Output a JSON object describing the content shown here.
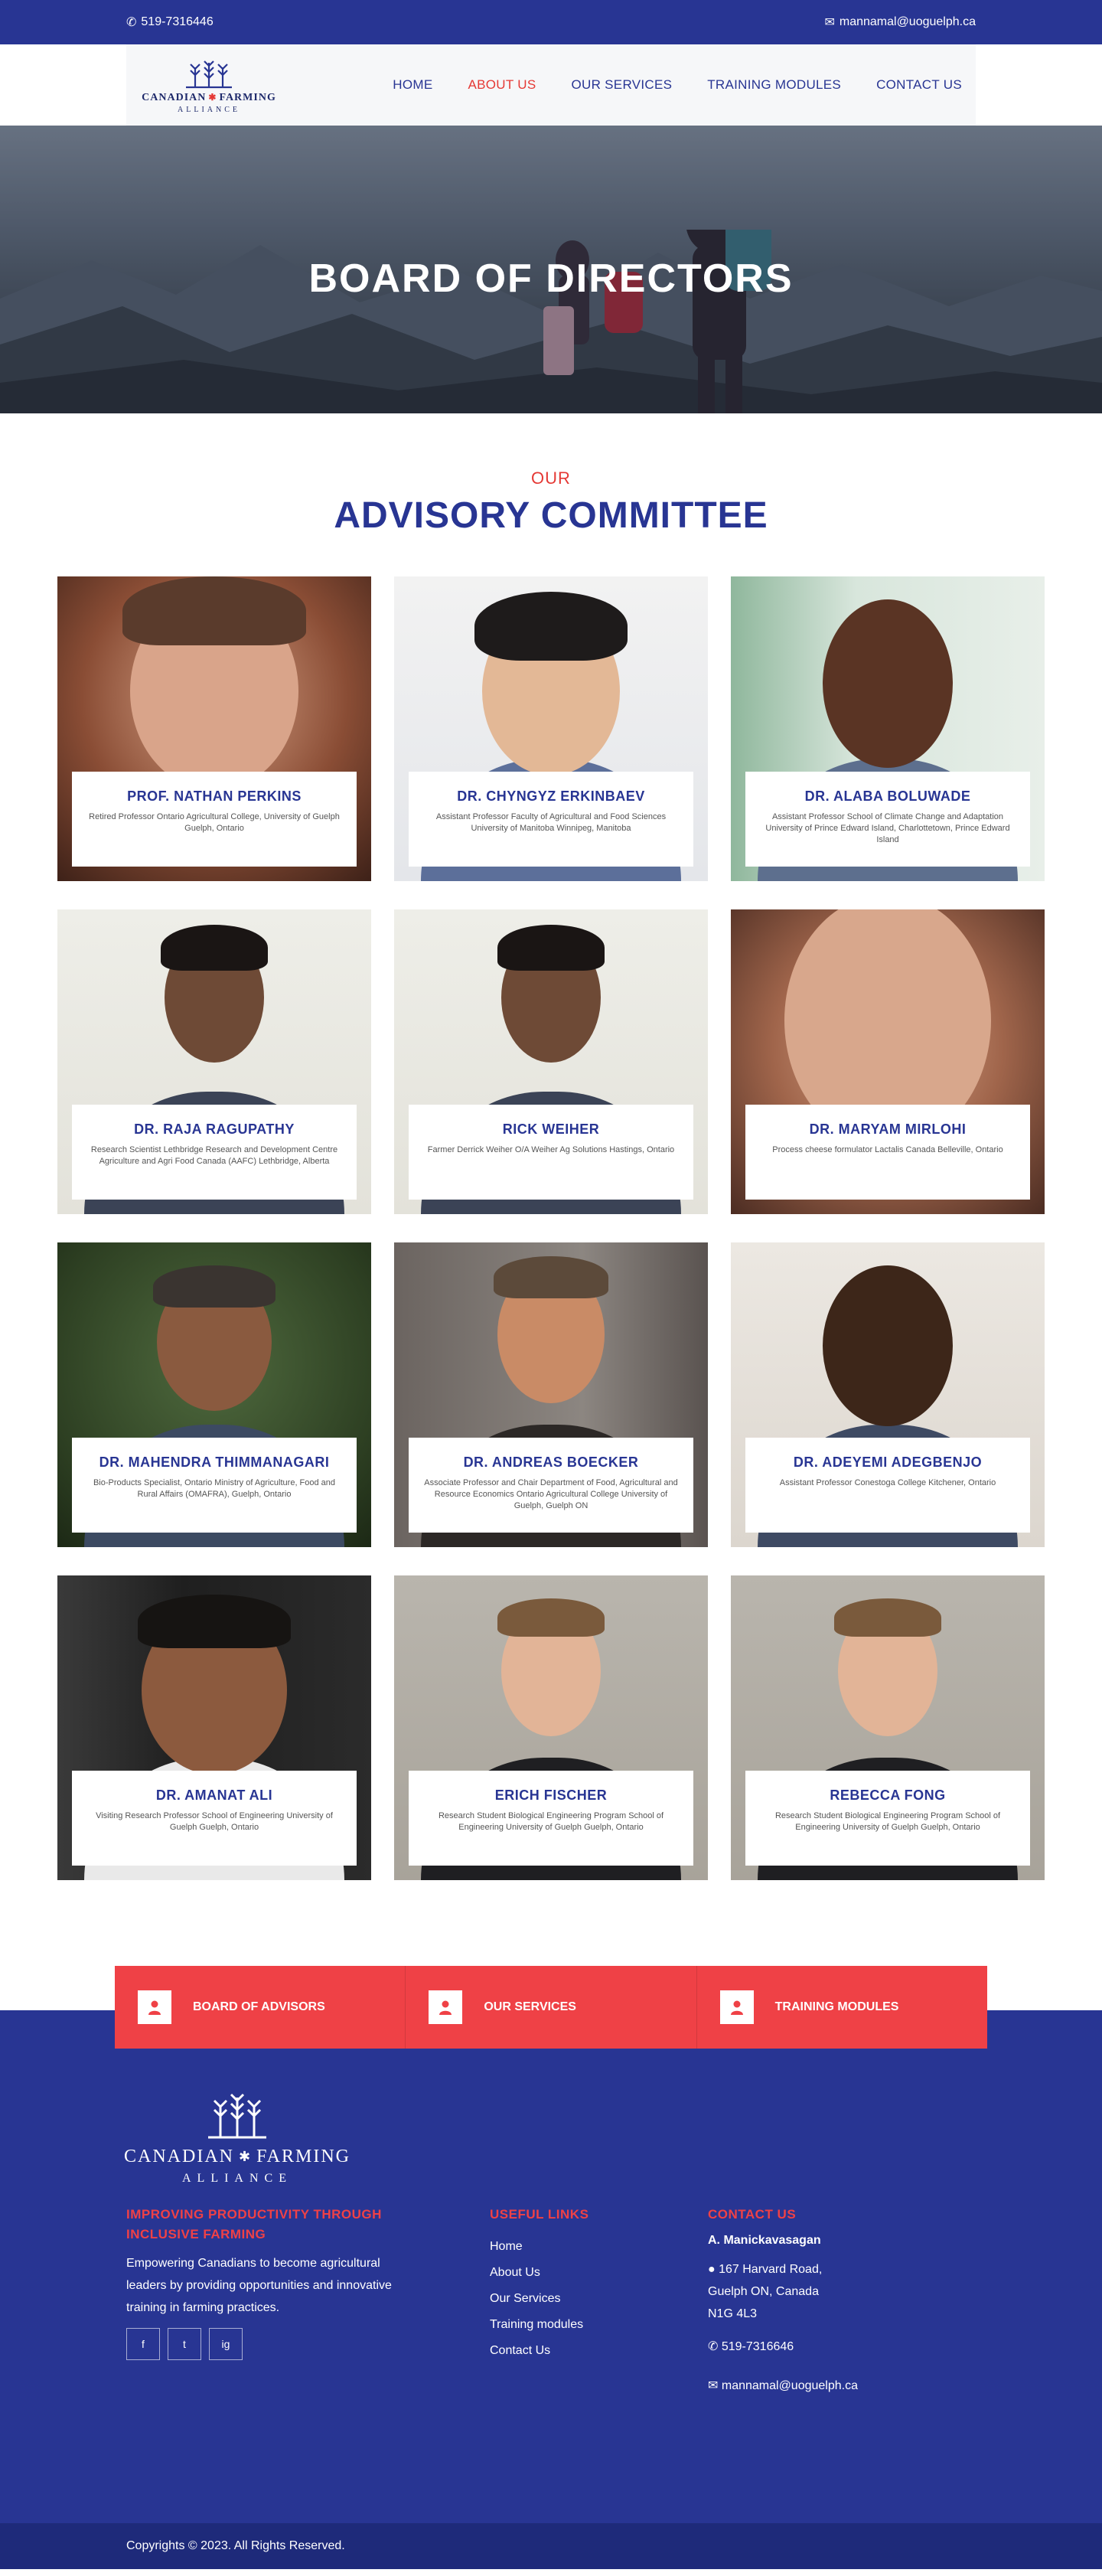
{
  "topbar": {
    "phone": "519-7316446",
    "email": "mannamal@uoguelph.ca"
  },
  "logo": {
    "brand_left": "CANADIAN",
    "brand_right": "FARMING",
    "alliance": "ALLIANCE"
  },
  "nav": {
    "items": [
      {
        "label": "HOME"
      },
      {
        "label": "ABOUT US"
      },
      {
        "label": "OUR SERVICES"
      },
      {
        "label": "TRAINING MODULES"
      },
      {
        "label": "CONTACT US"
      }
    ],
    "active_index": 1
  },
  "hero": {
    "title": "BOARD OF DIRECTORS"
  },
  "section": {
    "kicker": "OUR",
    "title": "ADVISORY COMMITTEE"
  },
  "members": [
    {
      "name": "PROF. NATHAN PERKINS",
      "role": "Retired Professor Ontario Agricultural College, University of Guelph Guelph, Ontario"
    },
    {
      "name": "DR. CHYNGYZ ERKINBAEV",
      "role": "Assistant Professor Faculty of Agricultural and Food Sciences University of Manitoba Winnipeg, Manitoba"
    },
    {
      "name": "DR. ALABA BOLUWADE",
      "role": "Assistant Professor School of Climate Change and Adaptation University of Prince Edward Island, Charlottetown, Prince Edward Island"
    },
    {
      "name": "DR. RAJA RAGUPATHY",
      "role": "Research Scientist Lethbridge Research and Development Centre Agriculture and Agri Food Canada (AAFC) Lethbridge, Alberta"
    },
    {
      "name": "RICK WEIHER",
      "role": "Farmer Derrick Weiher O/A Weiher Ag Solutions Hastings, Ontario"
    },
    {
      "name": "DR. MARYAM MIRLOHI",
      "role": "Process cheese formulator Lactalis Canada Belleville, Ontario"
    },
    {
      "name": "DR. MAHENDRA THIMMANAGARI",
      "role": "Bio-Products Specialist, Ontario Ministry of Agriculture, Food and Rural Affairs (OMAFRA), Guelph, Ontario"
    },
    {
      "name": "DR. ANDREAS BOECKER",
      "role": "Associate Professor and Chair Department of Food, Agricultural and Resource Economics Ontario Agricultural College University of Guelph, Guelph ON"
    },
    {
      "name": "DR. ADEYEMI ADEGBENJO",
      "role": "Assistant Professor Conestoga College Kitchener, Ontario"
    },
    {
      "name": "DR. AMANAT ALI",
      "role": "Visiting Research Professor School of Engineering University of Guelph Guelph, Ontario"
    },
    {
      "name": "ERICH FISCHER",
      "role": "Research Student Biological Engineering Program School of Engineering University of Guelph Guelph, Ontario"
    },
    {
      "name": "REBECCA FONG",
      "role": "Research Student Biological Engineering Program School of Engineering University of Guelph Guelph, Ontario"
    }
  ],
  "cta": {
    "items": [
      {
        "label": "BOARD OF ADVISORS",
        "icon": "user-icon"
      },
      {
        "label": "OUR SERVICES",
        "icon": "user-icon"
      },
      {
        "label": "TRAINING MODULES",
        "icon": "user-icon"
      }
    ]
  },
  "footer": {
    "logo_brand_left": "CANADIAN",
    "logo_brand_right": "FARMING",
    "logo_alliance": "ALLIANCE",
    "tagline": "IMPROVING PRODUCTIVITY THROUGH INCLUSIVE FARMING",
    "description": "Empowering Canadians to become agricultural leaders by providing opportunities and innovative training in farming practices.",
    "social": [
      "f",
      "t",
      "ig"
    ],
    "links_heading": "USEFUL LINKS",
    "links": [
      "Home",
      "About Us",
      "Our Services",
      "Training modules",
      "Contact Us"
    ],
    "contact_heading": "CONTACT US",
    "contact_name": "A. Manickavasagan",
    "address_line1": "167 Harvard Road,",
    "address_line2": "Guelph ON, Canada",
    "address_line3": "N1G 4L3",
    "phone": "519-7316646",
    "email": "mannamal@uoguelph.ca",
    "copyright": "Copyrights © 2023. All Rights Reserved."
  },
  "colors": {
    "brand_blue": "#283593",
    "accent_red": "#e53935",
    "cta_red": "#ef4146"
  }
}
